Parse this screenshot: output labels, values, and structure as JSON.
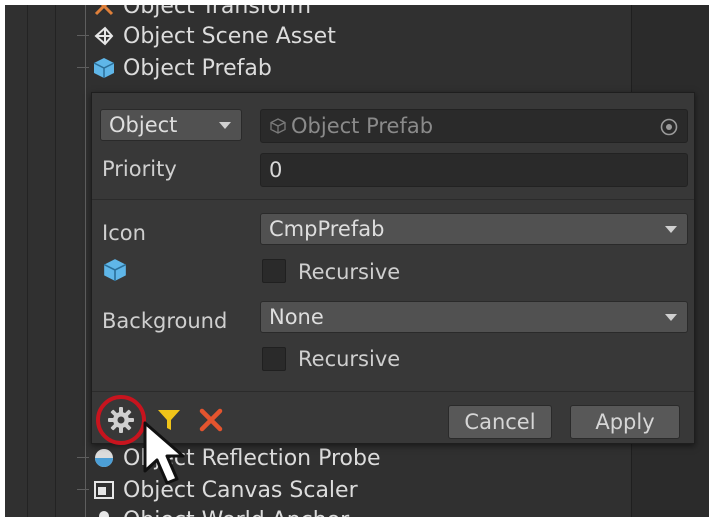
{
  "tree": {
    "items": [
      {
        "label": "Object Transform",
        "icon": "transform-icon"
      },
      {
        "label": "Object Scene Asset",
        "icon": "scene-asset-icon"
      },
      {
        "label": "Object Prefab",
        "icon": "prefab-cube-icon"
      },
      {
        "label": "Object Reflection Probe",
        "icon": "reflection-probe-icon"
      },
      {
        "label": "Object Canvas Scaler",
        "icon": "canvas-scaler-icon"
      },
      {
        "label": "Object World Anchor",
        "icon": "world-anchor-icon"
      }
    ]
  },
  "panel": {
    "type_dropdown": "Object",
    "object_field": "Object Prefab",
    "priority_label": "Priority",
    "priority_value": "0",
    "icon_label": "Icon",
    "icon_dropdown": "CmpPrefab",
    "recursive_label": "Recursive",
    "background_label": "Background",
    "background_dropdown": "None",
    "background_recursive_label": "Recursive",
    "cancel_label": "Cancel",
    "apply_label": "Apply"
  },
  "colors": {
    "accent_cube": "#5fb6e8",
    "filter_yellow": "#f0c419",
    "delete_red": "#e4542e",
    "highlight_ring": "#c8141e"
  }
}
